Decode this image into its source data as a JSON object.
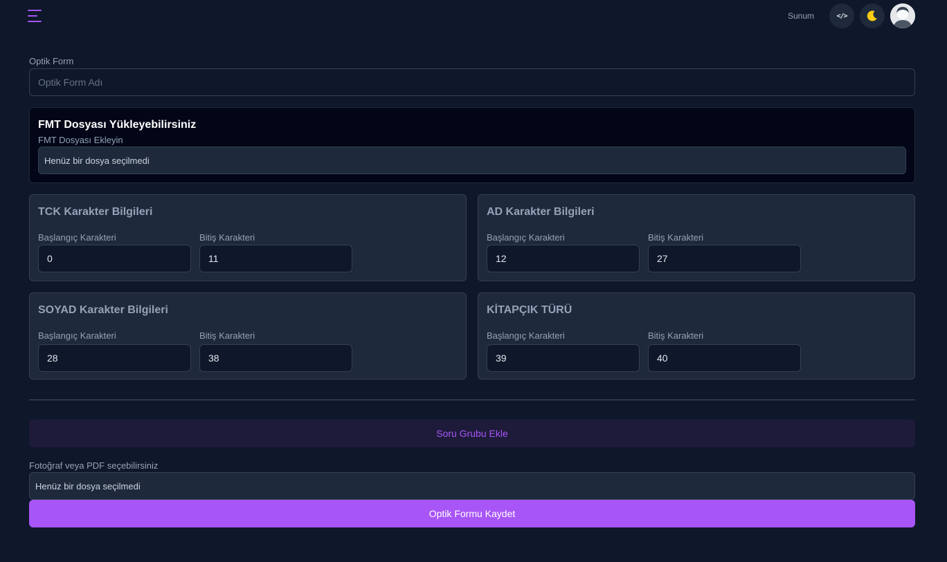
{
  "header": {
    "menu_icon": "hamburger-menu-icon",
    "presentation_label": "Sunum",
    "code_icon": "code-icon",
    "theme_icon": "moon-icon",
    "avatar_icon": "user-avatar"
  },
  "colors": {
    "background": "#0f172a",
    "accent": "#a855f7",
    "moon": "#facc15",
    "card": "#1e293b"
  },
  "form": {
    "name_label": "Optik Form",
    "name_placeholder": "Optik Form Adı",
    "name_value": ""
  },
  "fmt": {
    "title": "FMT Dosyası Yükleyebilirsiniz",
    "subtitle": "FMT Dosyası Ekleyin",
    "file_status": "Henüz bir dosya seçilmedi"
  },
  "cards": [
    {
      "title": "TCK Karakter Bilgileri",
      "start_label": "Başlangıç Karakteri",
      "end_label": "Bitiş Karakteri",
      "start": "0",
      "end": "11"
    },
    {
      "title": "AD Karakter Bilgileri",
      "start_label": "Başlangıç Karakteri",
      "end_label": "Bitiş Karakteri",
      "start": "12",
      "end": "27"
    },
    {
      "title": "SOYAD Karakter Bilgileri",
      "start_label": "Başlangıç Karakteri",
      "end_label": "Bitiş Karakteri",
      "start": "28",
      "end": "38"
    },
    {
      "title": "KİTAPÇIK TÜRÜ",
      "start_label": "Başlangıç Karakteri",
      "end_label": "Bitiş Karakteri",
      "start": "39",
      "end": "40"
    }
  ],
  "actions": {
    "add_group": "Soru Grubu Ekle",
    "upload_label": "Fotoğraf veya PDF seçebilirsiniz",
    "upload_status": "Henüz bir dosya seçilmedi",
    "save": "Optik Formu Kaydet"
  }
}
